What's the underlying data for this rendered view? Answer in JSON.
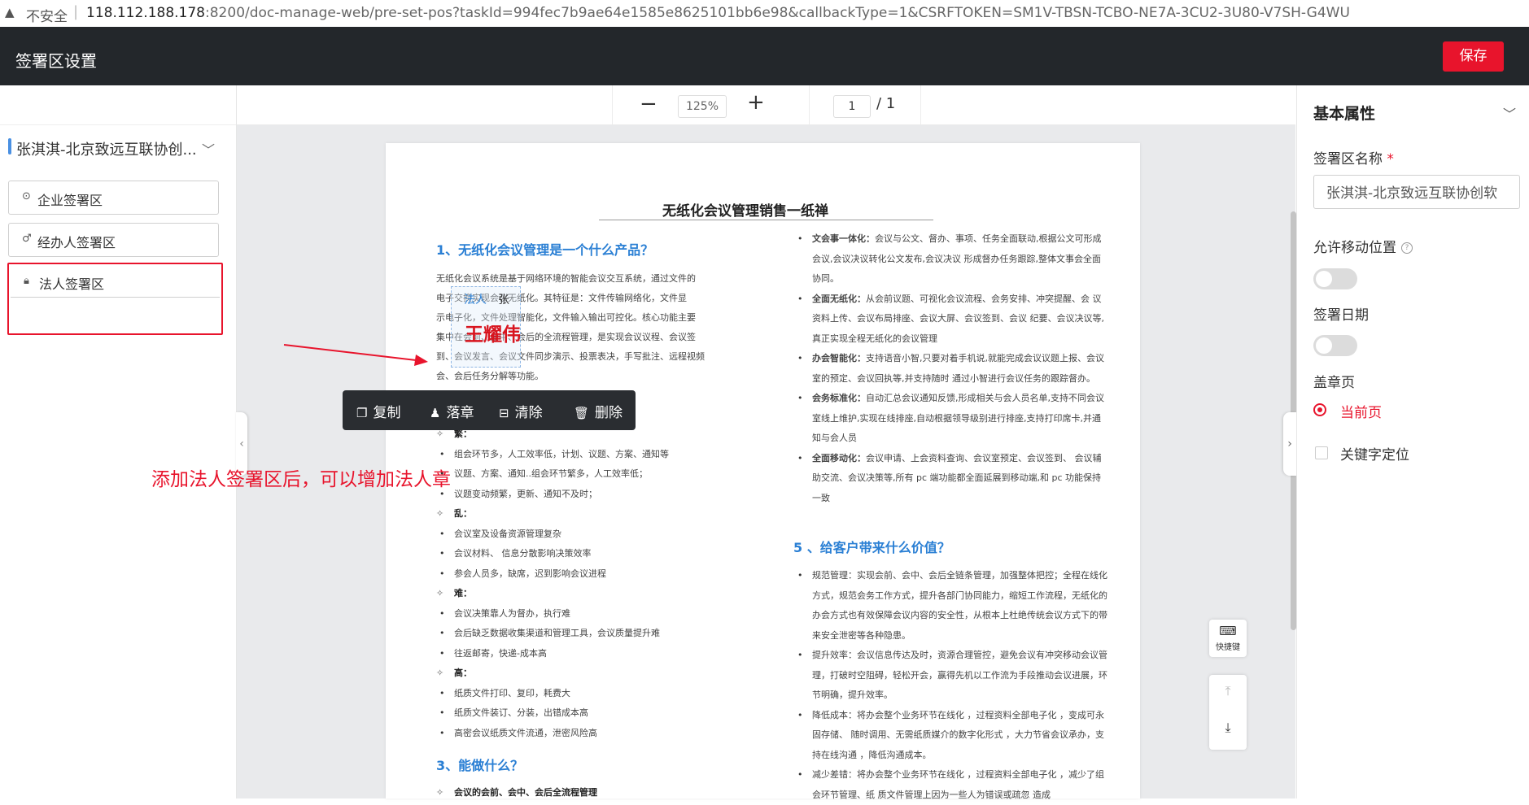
{
  "browser": {
    "security": "不安全",
    "url_host": "118.112.188.178",
    "url_rest": ":8200/doc-manage-web/pre-set-pos?taskId=994fec7b9ae64e1585e8625101bb6e98&callbackType=1&CSRFTOKEN=SM1V-TBSN-TCBO-NE7A-3CU2-3U80-V7SH-G4WU"
  },
  "header": {
    "title": "签署区设置",
    "save_label": "保存"
  },
  "left": {
    "doc_name": "张淇淇-北京致远互联协创...",
    "buttons": [
      {
        "label": "企业签署区",
        "icon": "seal-icon"
      },
      {
        "label": "经办人签署区",
        "icon": "person-icon"
      },
      {
        "label": "法人签署区",
        "icon": "lock-icon"
      }
    ]
  },
  "toolbar": {
    "zoom": "125%",
    "page": "1",
    "page_total": "/ 1"
  },
  "doc": {
    "title": "无纸化会议管理销售一纸禅",
    "h1": "1、无纸化会议管理是一个什么产品？",
    "intro": [
      "无纸化会议系统是基于网络环境的智能会议交互系统，通过文件的",
      "电子交换实现会议无纸化。其特征是：文件传输网络化，文件显",
      "示电子化，文件处理智能化，文件输入输出可控化。核心功能主要",
      "集中在会前、会中、会后的全流程管理，是实现会议议程、会议签",
      "到、会议发言、会议文件同步演示、投票表决，手写批注、远程视频",
      "会、会后任务分解等功能。"
    ],
    "list_a": [
      {
        "kind": "dia",
        "text": "繁："
      },
      {
        "kind": "dot",
        "text": "组会环节多，人工效率低，计划、议题、方案、通知等"
      },
      {
        "kind": "dot",
        "text": "议题、方案、通知..组会环节繁多，人工效率低；"
      },
      {
        "kind": "dot",
        "text": "议题变动频繁，更新、通知不及时；"
      },
      {
        "kind": "dia",
        "text": "乱："
      },
      {
        "kind": "dot",
        "text": "会议室及设备资源管理复杂"
      },
      {
        "kind": "dot",
        "text": "会议材料、  信息分散影响决策效率"
      },
      {
        "kind": "dot",
        "text": "参会人员多，缺席，迟到影响会议进程"
      },
      {
        "kind": "dia",
        "text": "难："
      },
      {
        "kind": "dot",
        "text": "会议决策靠人为督办，执行难"
      },
      {
        "kind": "dot",
        "text": "会后缺乏数据收集渠道和管理工具，会议质量提升难"
      },
      {
        "kind": "dot",
        "text": "往返邮寄，快递-成本高"
      },
      {
        "kind": "dia",
        "text": "高："
      },
      {
        "kind": "dot",
        "text": "纸质文件打印、复印，耗费大"
      },
      {
        "kind": "dot",
        "text": "纸质文件装订、分装，出错成本高"
      },
      {
        "kind": "dot",
        "text": "高密会议纸质文件流通，泄密风险高"
      }
    ],
    "h3": "3、能做什么？",
    "h3_item": "会议的会前、会中、会后全流程管理",
    "list_b": [
      {
        "b": "文会事一体化：",
        "t": "会议与公文、督办、事项、任务全面联动,根据公文可形成会议,会议决议转化公文发布,会议决议 形成督办任务跟踪,整体文事会全面协同。"
      },
      {
        "b": "全面无纸化：",
        "t": "从会前议题、可视化会议流程、会务安排、冲突提醒、会 议资料上传、会议布局排座、会议大屏、会议签到、会议 纪要、会议决议等,真正实现全程无纸化的会议管理"
      },
      {
        "b": "办会智能化：",
        "t": "支持语音小智,只要对着手机说,就能完成会议议题上报、会议室的预定、会议回执等,并支持随时 通过小智进行会议任务的跟踪督办。"
      },
      {
        "b": "会务标准化：",
        "t": "自动汇总会议通知反馈,形成相关与会人员名单,支持不同会议室线上维护,实现在线排座,自动根据领导级别进行排座,支持打印席卡,并通知与会人员"
      },
      {
        "b": "全面移动化：",
        "t": "会议申请、上会资料查询、会议室预定、会议签到、  会议辅助交流、会议决策等,所有 pc 端功能都全面延展到移动端,和 pc 功能保持一致"
      }
    ],
    "h5": "5 、给客户带来什么价值？",
    "list_c": [
      {
        "b": "",
        "t": "规范管理：实现会前、会中、会后全链条管理，加强整体把控；全程在线化方式，规范会务工作方式，提升各部门协同能力，缩短工作流程，无纸化的办会方式也有效保障会议内容的安全性，从根本上杜绝传统会议方式下的带来安全泄密等各种隐患。"
      },
      {
        "b": "",
        "t": "提升效率：会议信息传达及时，资源合理管控，避免会议有冲突移动会议管理，打破时空阻碍，轻松开会，赢得先机以工作流为手段推动会议进展，环节明确，提升效率。"
      },
      {
        "b": "",
        "t": "降低成本：将办会整个业务环节在线化 ，过程资料全部电子化 ，变成可永固存储、 随时调用、无需纸质媒介的数字化形式 ，大力节省会议承办，支持在线沟通 ，降低沟通成本。"
      },
      {
        "b": "",
        "t": "减少差错：将办会整个业务环节在线化 ，过程资料全部电子化 ，减少了组会环节管理、纸 质文件管理上因为一些人为错误或疏忽 造成"
      }
    ],
    "sig_label": "法人",
    "sig_name_partial": "张",
    "seal_name": "王耀伟"
  },
  "context_menu": [
    {
      "label": "复制",
      "icon": "copy-icon"
    },
    {
      "label": "落章",
      "icon": "stamp-icon"
    },
    {
      "label": "清除",
      "icon": "clear-icon"
    },
    {
      "label": "删除",
      "icon": "trash-icon"
    }
  ],
  "annotation": "添加法人签署区后，可以增加法人章",
  "right": {
    "section": "基本属性",
    "name_label": "签署区名称",
    "name_value": "张淇淇-北京致远互联协创软",
    "move_label": "允许移动位置",
    "move_enabled": false,
    "date_label": "签署日期",
    "date_enabled": false,
    "page_label": "盖章页",
    "current_page": "当前页",
    "keyword": "关键字定位"
  },
  "float": {
    "shortcut": "快捷键"
  },
  "colors": {
    "accent": "#e8142c",
    "link": "#2a7fd4",
    "header_bg": "#23272b"
  }
}
